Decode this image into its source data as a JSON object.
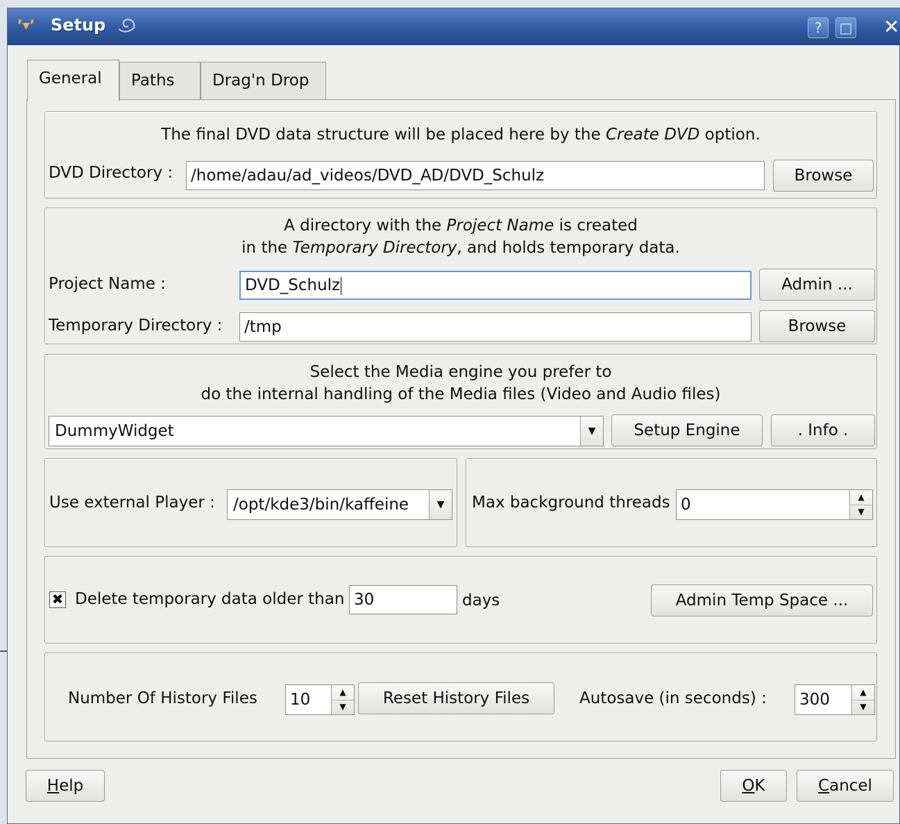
{
  "window": {
    "title": "Setup",
    "help_glyph": "?",
    "maximize_glyph": "□",
    "close_glyph": "✕"
  },
  "tabs": [
    {
      "label": "General",
      "active": true
    },
    {
      "label": "Paths",
      "active": false
    },
    {
      "label": "Drag'n Drop",
      "active": false
    }
  ],
  "dvd": {
    "info_before": "The final DVD data structure will be placed here by the ",
    "info_em": "Create DVD",
    "info_after": " option.",
    "label": "DVD Directory :",
    "value": "/home/adau/ad_videos/DVD_AD/DVD_Schulz",
    "browse_label": "Browse"
  },
  "project": {
    "info_line1_before": "A directory with the ",
    "info_line1_em": "Project Name",
    "info_line1_after": " is created",
    "info_line2_before": "in the ",
    "info_line2_em": "Temporary Directory",
    "info_line2_after": ", and holds temporary data.",
    "name_label": "Project Name :",
    "name_value": "DVD_Schulz",
    "admin_label": "Admin ...",
    "temp_label": "Temporary Directory :",
    "temp_value": "/tmp",
    "temp_browse_label": "Browse"
  },
  "media": {
    "info_line1": "Select the Media engine you prefer to",
    "info_line2": "do the internal handling of the Media files (Video and Audio files)",
    "engine_value": "DummyWidget",
    "setup_engine_label": "Setup Engine",
    "info_button_label": ". Info ."
  },
  "player": {
    "label": "Use external Player :",
    "value": "/opt/kde3/bin/kaffeine"
  },
  "threads": {
    "label": "Max background threads",
    "value": "0"
  },
  "cleanup": {
    "checked": true,
    "check_glyph": "✖",
    "label": "Delete temporary data older than",
    "days_value": "30",
    "days_unit": "days",
    "admin_temp_label": "Admin Temp Space ..."
  },
  "history": {
    "label": "Number Of History Files",
    "value": "10",
    "reset_label": "Reset History Files",
    "autosave_label": "Autosave (in seconds) :",
    "autosave_value": "300"
  },
  "footer": {
    "help_mnemonic": "H",
    "help_rest": "elp",
    "ok_mnemonic": "O",
    "ok_rest": "K",
    "cancel_mnemonic": "C",
    "cancel_rest": "ancel"
  },
  "colors": {
    "titlebar": "#2f5aa2",
    "window_bg": "#eeeeec",
    "focus_border": "#6e93c9"
  }
}
